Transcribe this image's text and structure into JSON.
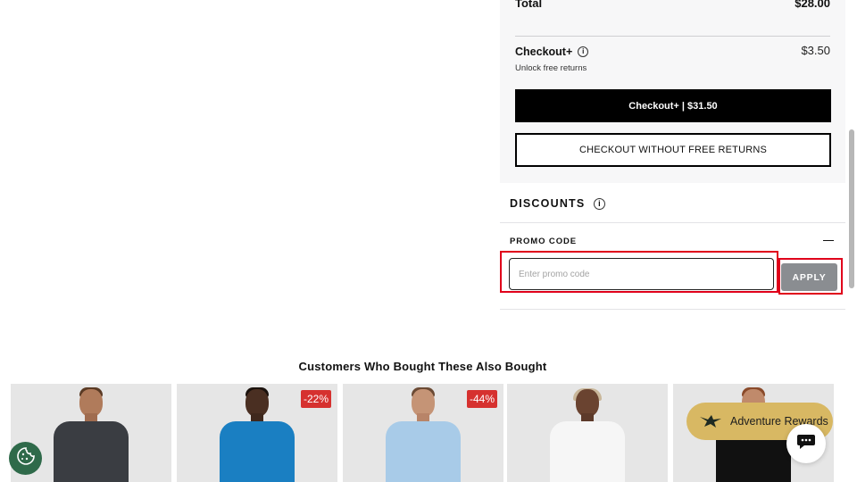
{
  "summary": {
    "total_label": "Total",
    "total_value": "$28.00",
    "checkout_plus_title": "Checkout+",
    "checkout_plus_subtitle": "Unlock free returns",
    "checkout_plus_price": "$3.50",
    "checkout_plus_button": "Checkout+ | $31.50",
    "checkout_without_button": "CHECKOUT WITHOUT FREE RETURNS"
  },
  "discounts": {
    "title": "DISCOUNTS",
    "promo_label": "PROMO CODE",
    "promo_placeholder": "Enter promo code",
    "promo_value": "",
    "apply_label": "APPLY"
  },
  "recommendations": {
    "title": "Customers Who Bought These Also Bought",
    "products": [
      {
        "badge": "",
        "shirt_color": "#3a3d42",
        "skin": "#b07b5b"
      },
      {
        "badge": "-22%",
        "shirt_color": "#1a7fc2",
        "skin": "#4a2f22"
      },
      {
        "badge": "-44%",
        "shirt_color": "#a8cbe8",
        "skin": "#c59476"
      },
      {
        "badge": "",
        "shirt_color": "#f6f6f6",
        "skin": "#6a4330"
      },
      {
        "badge": "",
        "shirt_color": "#111111",
        "skin": "#c08a6b"
      }
    ]
  },
  "rewards": {
    "label": "Adventure Rewards"
  },
  "colors": {
    "panel_bg": "#f7f7f8",
    "primary_button": "#000000",
    "apply_button": "#8a8d91",
    "highlight_frame": "#e0001b",
    "badge": "#d6312f",
    "rewards_bg": "#d8b863",
    "cookie_bg": "#2f6a4a"
  },
  "icons": {
    "info": "info-icon",
    "collapse": "minus-icon",
    "rewards": "bird-icon",
    "chat": "chat-bubble-icon",
    "cookie": "cookie-icon"
  }
}
